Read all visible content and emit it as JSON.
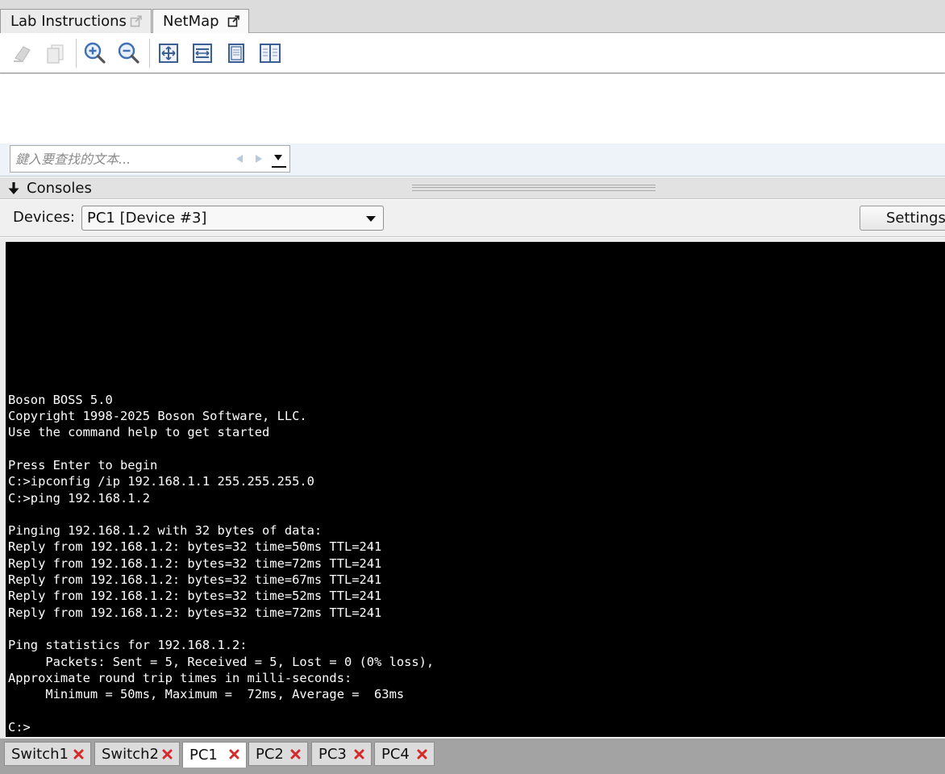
{
  "top_tabs": [
    {
      "label": "Lab Instructions",
      "icon": "external-link-icon",
      "active": false
    },
    {
      "label": "NetMap",
      "icon": "external-link-icon",
      "active": true
    }
  ],
  "toolbar": {
    "buttons": [
      "eraser-icon",
      "copy-icon",
      "zoom-in-icon",
      "zoom-out-icon",
      "fit-all-icon",
      "fit-width-icon",
      "single-page-icon",
      "two-page-icon"
    ]
  },
  "find_bar": {
    "placeholder": "鍵入要查找的文本...",
    "value": ""
  },
  "consoles": {
    "title": "Consoles"
  },
  "devices": {
    "label": "Devices:",
    "selected": "PC1 [Device #3]",
    "settings_label": "Settings..."
  },
  "console": {
    "lines": [
      "Boson BOSS 5.0",
      "Copyright 1998-2025 Boson Software, LLC.",
      "Use the command help to get started",
      "",
      "Press Enter to begin",
      "C:>ipconfig /ip 192.168.1.1 255.255.255.0",
      "C:>ping 192.168.1.2",
      "",
      "Pinging 192.168.1.2 with 32 bytes of data:",
      "Reply from 192.168.1.2: bytes=32 time=50ms TTL=241",
      "Reply from 192.168.1.2: bytes=32 time=72ms TTL=241",
      "Reply from 192.168.1.2: bytes=32 time=67ms TTL=241",
      "Reply from 192.168.1.2: bytes=32 time=52ms TTL=241",
      "Reply from 192.168.1.2: bytes=32 time=72ms TTL=241",
      "",
      "Ping statistics for 192.168.1.2:",
      "     Packets: Sent = 5, Received = 5, Lost = 0 (0% loss),",
      "Approximate round trip times in milli-seconds:",
      "     Minimum = 50ms, Maximum =  72ms, Average =  63ms",
      "",
      "C:>"
    ]
  },
  "device_tabs": [
    {
      "label": "Switch1",
      "active": false
    },
    {
      "label": "Switch2",
      "active": false
    },
    {
      "label": "PC1",
      "active": true
    },
    {
      "label": "PC2",
      "active": false
    },
    {
      "label": "PC3",
      "active": false
    },
    {
      "label": "PC4",
      "active": false
    }
  ],
  "colors": {
    "console_bg": "#000000",
    "console_fg": "#ffffff",
    "close_red": "#d42a2a",
    "accent_blue": "#3f6fb5"
  }
}
